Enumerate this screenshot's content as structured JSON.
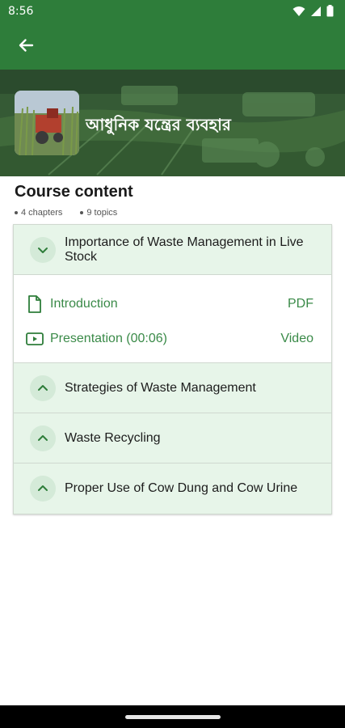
{
  "status_bar": {
    "time": "8:56"
  },
  "banner": {
    "course_title": "আধুনিক যন্ত্রের ব্যবহার"
  },
  "content": {
    "heading": "Course content",
    "chapters_count": "4 chapters",
    "topics_count": "9 topics"
  },
  "chapters": [
    {
      "title": "Importance of Waste Management in Live Stock",
      "expanded": true,
      "topics": [
        {
          "label": "Introduction",
          "type": "PDF",
          "icon": "document-icon"
        },
        {
          "label": "Presentation (00:06)",
          "type": "Video",
          "icon": "video-icon"
        }
      ]
    },
    {
      "title": "Strategies of Waste Management",
      "expanded": false
    },
    {
      "title": "Waste Recycling",
      "expanded": false
    },
    {
      "title": "Proper Use of Cow Dung and Cow Urine",
      "expanded": false
    }
  ],
  "colors": {
    "primary": "#2e7d3a",
    "chapter_bg": "#e7f5e9",
    "topic_text": "#3a8a48"
  }
}
